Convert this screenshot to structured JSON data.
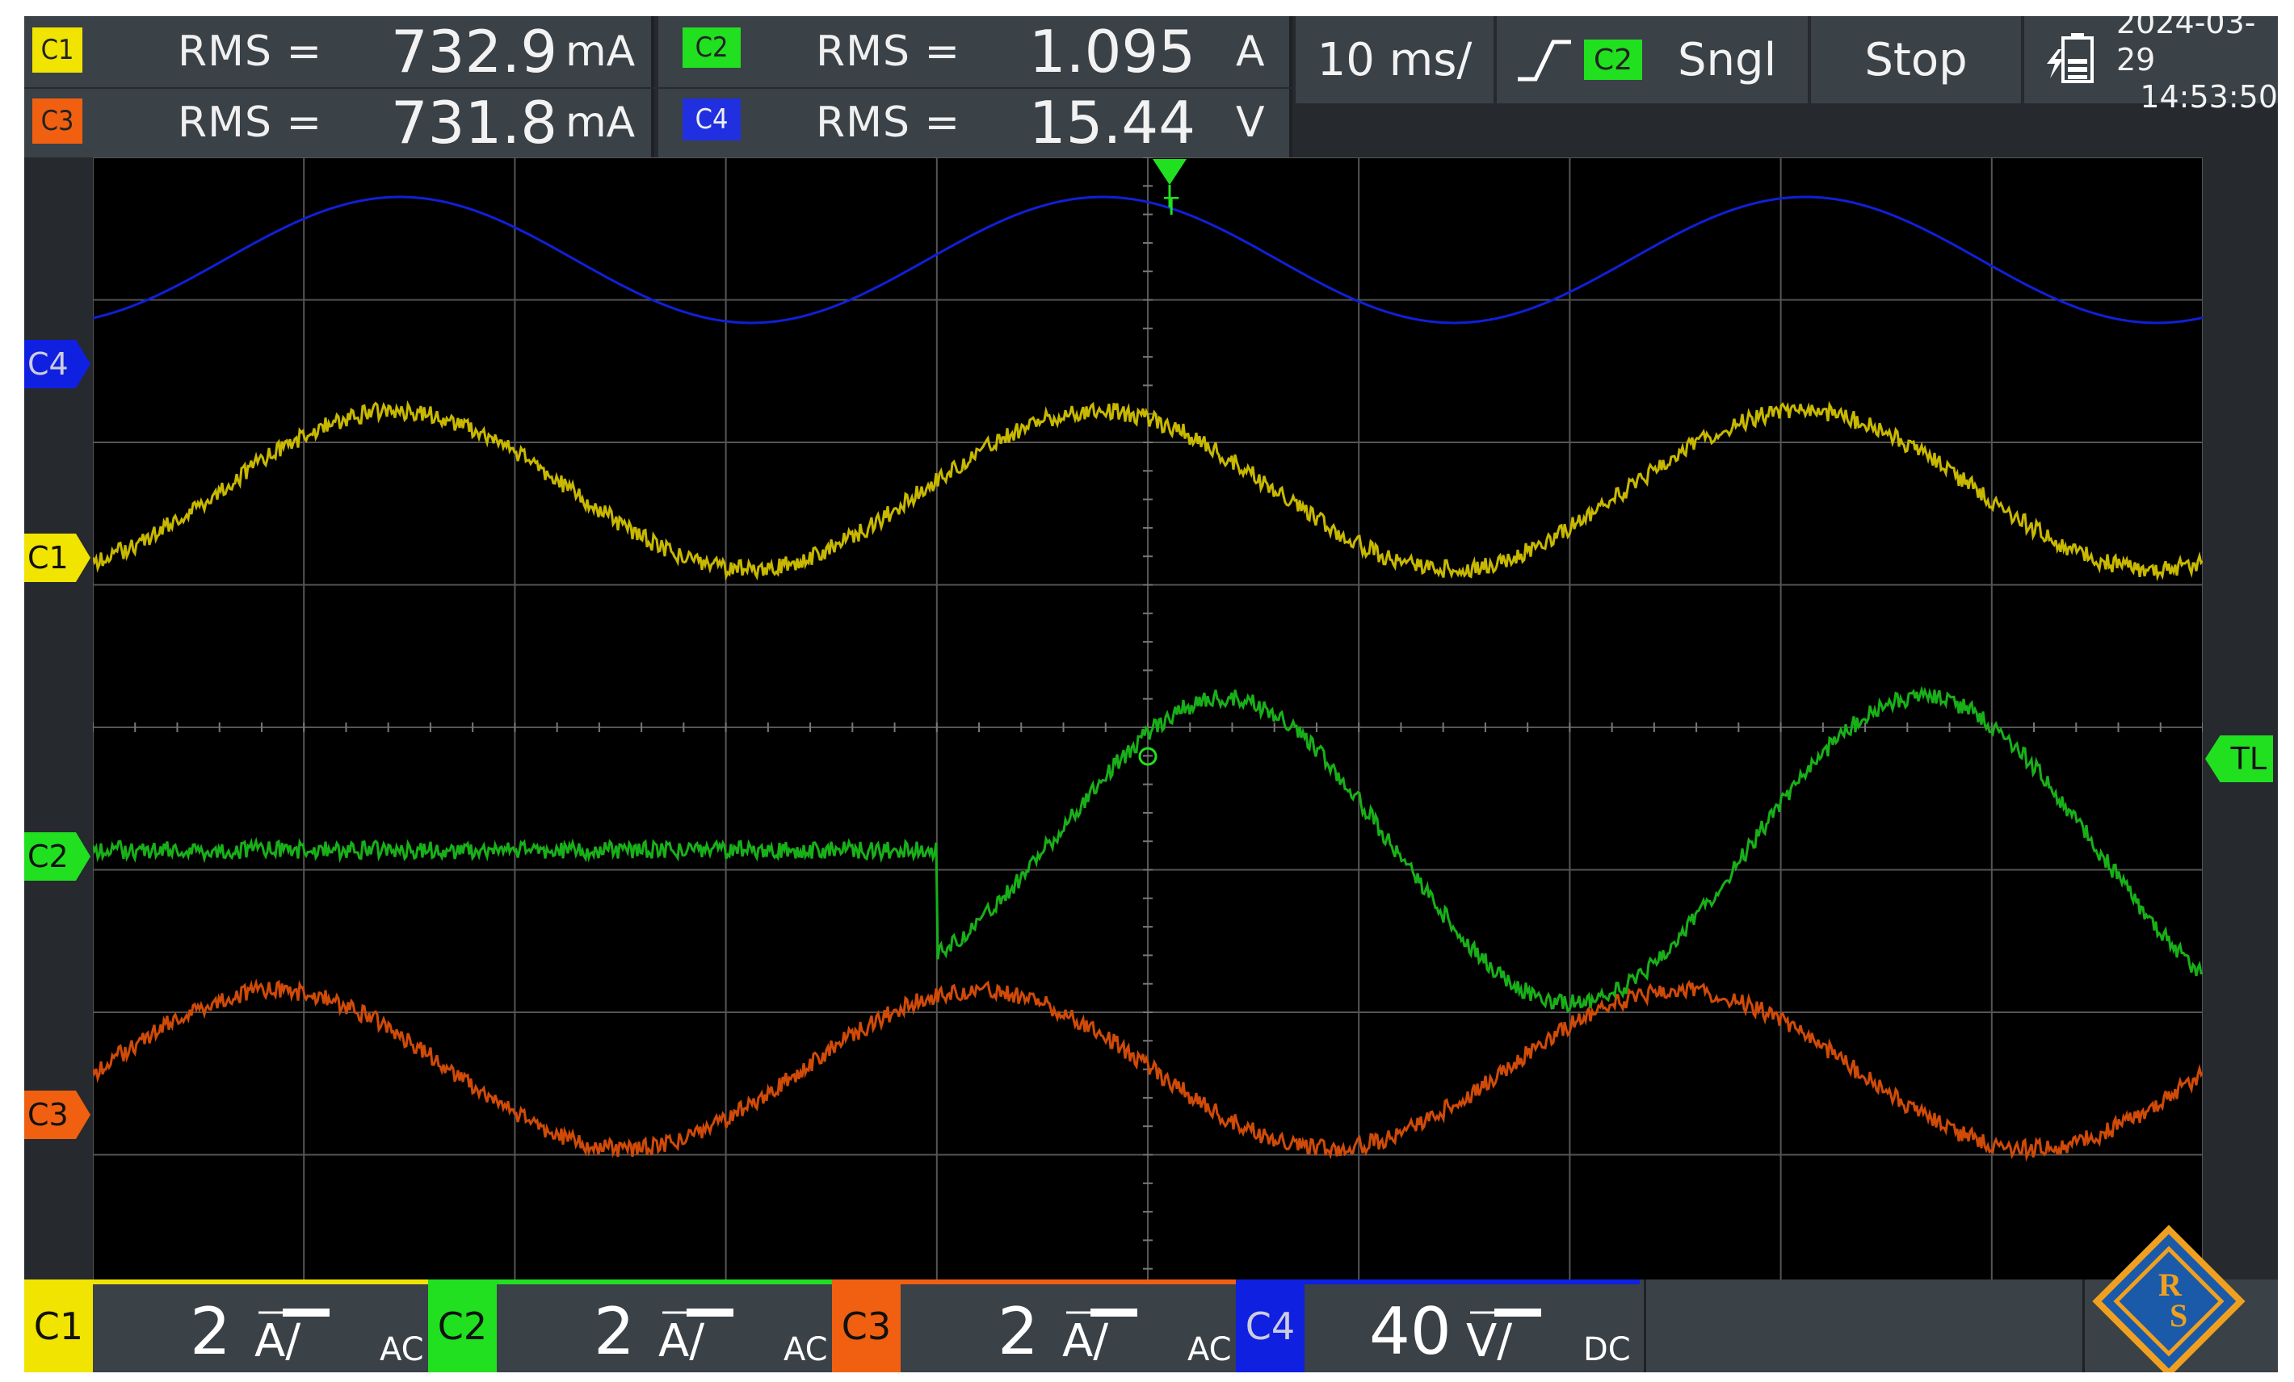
{
  "measurements": [
    {
      "channel": "C1",
      "label": "RMS =",
      "value": "732.9",
      "unit": "mA",
      "color": "#f0e400"
    },
    {
      "channel": "C3",
      "label": "RMS =",
      "value": "731.8",
      "unit": "mA",
      "color": "#f06010"
    },
    {
      "channel": "C2",
      "label": "RMS =",
      "value": "1.095",
      "unit": "A",
      "color": "#20e020"
    },
    {
      "channel": "C4",
      "label": "RMS =",
      "value": "15.44",
      "unit": "V",
      "color": "#2030e0"
    }
  ],
  "timebase": "10 ms/",
  "trigger": {
    "source": "C2",
    "mode": "Sngl",
    "icon": "rising-edge-icon"
  },
  "run_state": "Stop",
  "datetime": {
    "date": "2024-03-29",
    "time": "14:53:50"
  },
  "markers": {
    "trigger": "T",
    "trigger_level": "TL"
  },
  "channels": [
    {
      "name": "C1",
      "scale": "2",
      "unit": "A/",
      "coupling": "AC",
      "color": "#f0e400",
      "trace": "#c8b800"
    },
    {
      "name": "C2",
      "scale": "2",
      "unit": "A/",
      "coupling": "AC",
      "color": "#20e020",
      "trace": "#18b018"
    },
    {
      "name": "C3",
      "scale": "2",
      "unit": "A/",
      "coupling": "AC",
      "color": "#f06010",
      "trace": "#d04a08"
    },
    {
      "name": "C4",
      "scale": "40",
      "unit": "V/",
      "coupling": "DC",
      "color": "#1020e0",
      "trace": "#1020d8"
    }
  ],
  "logo": "R&S"
}
